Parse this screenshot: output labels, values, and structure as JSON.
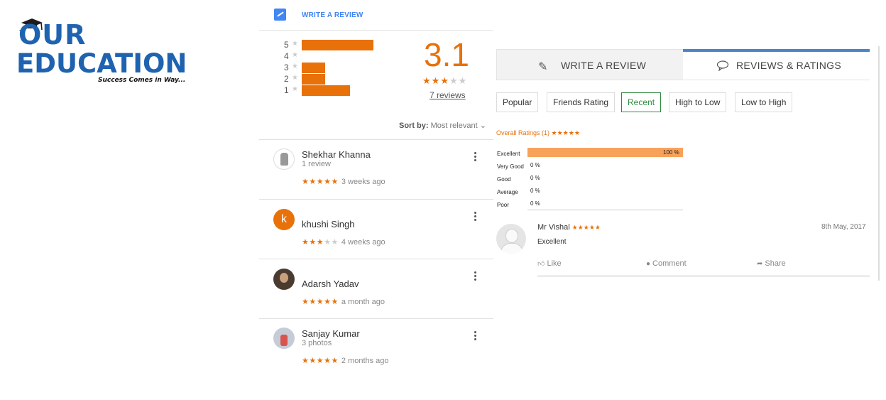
{
  "colors": {
    "brand_blue": "#1f63b0",
    "accent_orange": "#e8710a",
    "google_blue": "#4285f4",
    "active_green": "#2e8b3e"
  },
  "logo": {
    "line1": "OUR",
    "line2": "EDUCATION",
    "tagline": "Success Comes in Way..."
  },
  "google_panel": {
    "write_review_label": "WRITE A REVIEW",
    "histogram": [
      {
        "stars": "5",
        "fraction": 0.82
      },
      {
        "stars": "4",
        "fraction": 0.0
      },
      {
        "stars": "3",
        "fraction": 0.27
      },
      {
        "stars": "2",
        "fraction": 0.27
      },
      {
        "stars": "1",
        "fraction": 0.55
      }
    ],
    "average": "3.1",
    "average_stars": 3,
    "review_count": "7 reviews",
    "sort_label": "Sort by:",
    "sort_value": "Most relevant",
    "reviews": [
      {
        "name": "Shekhar Khanna",
        "sub": "1 review",
        "stars": 5,
        "time": "3 weeks ago",
        "avatar": "emblem-avatar"
      },
      {
        "name": "khushi Singh",
        "sub": "",
        "stars": 3,
        "time": "4 weeks ago",
        "avatar_letter": "k"
      },
      {
        "name": "Adarsh Yadav",
        "sub": "",
        "stars": 5,
        "time": "a month ago",
        "avatar": "photo-avatar"
      },
      {
        "name": "Sanjay Kumar",
        "sub": "3 photos",
        "stars": 5,
        "time": "2 months ago",
        "avatar": "photo-avatar"
      }
    ]
  },
  "right_panel": {
    "tabs": [
      {
        "label": "WRITE A REVIEW",
        "icon": "pencil-icon",
        "active": false
      },
      {
        "label": "REVIEWS & RATINGS",
        "icon": "speech-bubble-icon",
        "active": true
      }
    ],
    "filters": [
      {
        "label": "Popular",
        "active": false
      },
      {
        "label": "Friends Rating",
        "active": false
      },
      {
        "label": "Recent",
        "active": true
      },
      {
        "label": "High to Low",
        "active": false
      },
      {
        "label": "Low to High",
        "active": false
      }
    ],
    "overall_label": "Overall Ratings (1)",
    "overall_stars": "★★★★★",
    "distribution": [
      {
        "label": "Excellent",
        "percent": 100,
        "text": "100 %"
      },
      {
        "label": "Very Good",
        "percent": 0,
        "text": "0 %"
      },
      {
        "label": "Good",
        "percent": 0,
        "text": "0 %"
      },
      {
        "label": "Average",
        "percent": 0,
        "text": "0 %"
      },
      {
        "label": "Poor",
        "percent": 0,
        "text": "0 %"
      }
    ],
    "review": {
      "name": "Mr Vishal",
      "stars": "★★★★★",
      "date": "8th May, 2017",
      "text": "Excellent",
      "actions": {
        "like": "Like",
        "comment": "Comment",
        "share": "Share"
      }
    }
  }
}
